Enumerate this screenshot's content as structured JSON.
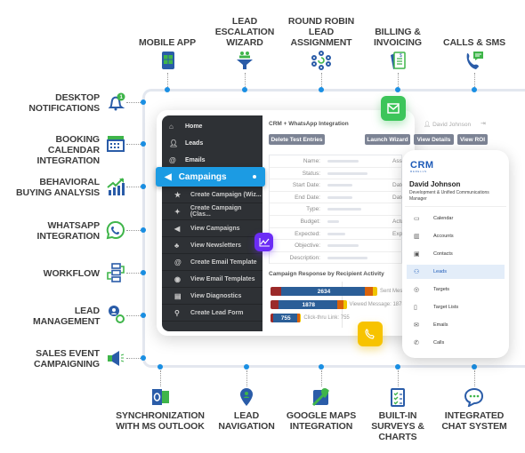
{
  "colors": {
    "blue": "#2a5ca8",
    "green": "#3fb54a",
    "accent": "#1c9be3",
    "sidebar": "#2e3135",
    "badge_green": "#3cc55a",
    "badge_purple": "#6b2cf5",
    "badge_yellow": "#f7c300"
  },
  "top_features": [
    {
      "label": "Mobile App",
      "icon": "mobile-app-icon"
    },
    {
      "label": "Lead Escalation Wizard",
      "icon": "funnel-icon"
    },
    {
      "label": "Round Robin Lead Assignment",
      "icon": "network-icon"
    },
    {
      "label": "Billing & Invoicing",
      "icon": "invoice-icon"
    },
    {
      "label": "Calls & SMS",
      "icon": "phone-chat-icon"
    }
  ],
  "left_features": [
    {
      "label": "Desktop Notifications",
      "icon": "bell-icon",
      "badge": "1"
    },
    {
      "label": "Booking Calendar Integration",
      "icon": "calendar-icon"
    },
    {
      "label": "Behavioral Buying Analysis",
      "icon": "growth-chart-icon"
    },
    {
      "label": "WhatsApp Integration",
      "icon": "whatsapp-icon"
    },
    {
      "label": "Workflow",
      "icon": "workflow-icon"
    },
    {
      "label": "Lead Management",
      "icon": "gear-user-icon"
    },
    {
      "label": "Sales Event Campaigning",
      "icon": "megaphone-icon"
    }
  ],
  "bottom_features": [
    {
      "label": "Synchronization with MS Outlook",
      "icon": "outlook-icon"
    },
    {
      "label": "Lead Navigation",
      "icon": "map-pin-icon"
    },
    {
      "label": "Google Maps Integration",
      "icon": "google-maps-icon"
    },
    {
      "label": "Built-in Surveys & Charts",
      "icon": "survey-icon"
    },
    {
      "label": "Integrated Chat System",
      "icon": "chat-icon"
    }
  ],
  "dashboard": {
    "sidebar": {
      "items": [
        {
          "label": "Home",
          "icon": "home-icon"
        },
        {
          "label": "Leads",
          "icon": "user-icon"
        },
        {
          "label": "Emails",
          "icon": "at-icon"
        }
      ],
      "active": "Campaings",
      "sub_items": [
        "Create Campaign (Wiz...",
        "Create Campaign (Clas...",
        "View Campaigns",
        "View Newsletters",
        "Create Email Template",
        "View Email Templates",
        "View Diagnostics",
        "Create Lead Form"
      ]
    },
    "title": "CRM + WhatsApp Integration",
    "user": "David Johnson",
    "buttons": {
      "delete": "Delete Test Entries",
      "launch": "Launch Wizard",
      "details": "View Details",
      "roi": "View ROI"
    },
    "fields": [
      "Name:",
      "Status:",
      "Start Date:",
      "End Date:",
      "Type:",
      "Budget:",
      "Expected:",
      "Objective:",
      "Description:"
    ],
    "fields_right": [
      "Ass",
      "",
      "Date M",
      "Date C",
      "",
      "Actual C",
      "Expected C",
      "",
      ""
    ],
    "chart_title": "Campaign Response by Recipient Activity",
    "chart_data": {
      "type": "bar",
      "categories": [
        "Sent Message",
        "Viewed Message",
        "Click-thru Link"
      ],
      "values": [
        2634,
        1878,
        755
      ],
      "labels": [
        "Sent M",
        "Viewed Message: 1878",
        "Click-thru Link: 755"
      ]
    }
  },
  "mobile": {
    "logo": "CRM",
    "logo_sub": "MERELUS",
    "name": "David Johnson",
    "role": "Development & Unified Communications Manager",
    "menu": [
      {
        "label": "Calendar",
        "icon": "calendar-icon"
      },
      {
        "label": "Accounts",
        "icon": "building-icon"
      },
      {
        "label": "Contacts",
        "icon": "contact-card-icon"
      },
      {
        "label": "Leads",
        "icon": "lead-icon",
        "active": true
      },
      {
        "label": "Targets",
        "icon": "target-icon"
      },
      {
        "label": "Target Lists",
        "icon": "list-icon"
      },
      {
        "label": "Emails",
        "icon": "mail-icon"
      },
      {
        "label": "Calls",
        "icon": "phone-icon"
      }
    ]
  }
}
